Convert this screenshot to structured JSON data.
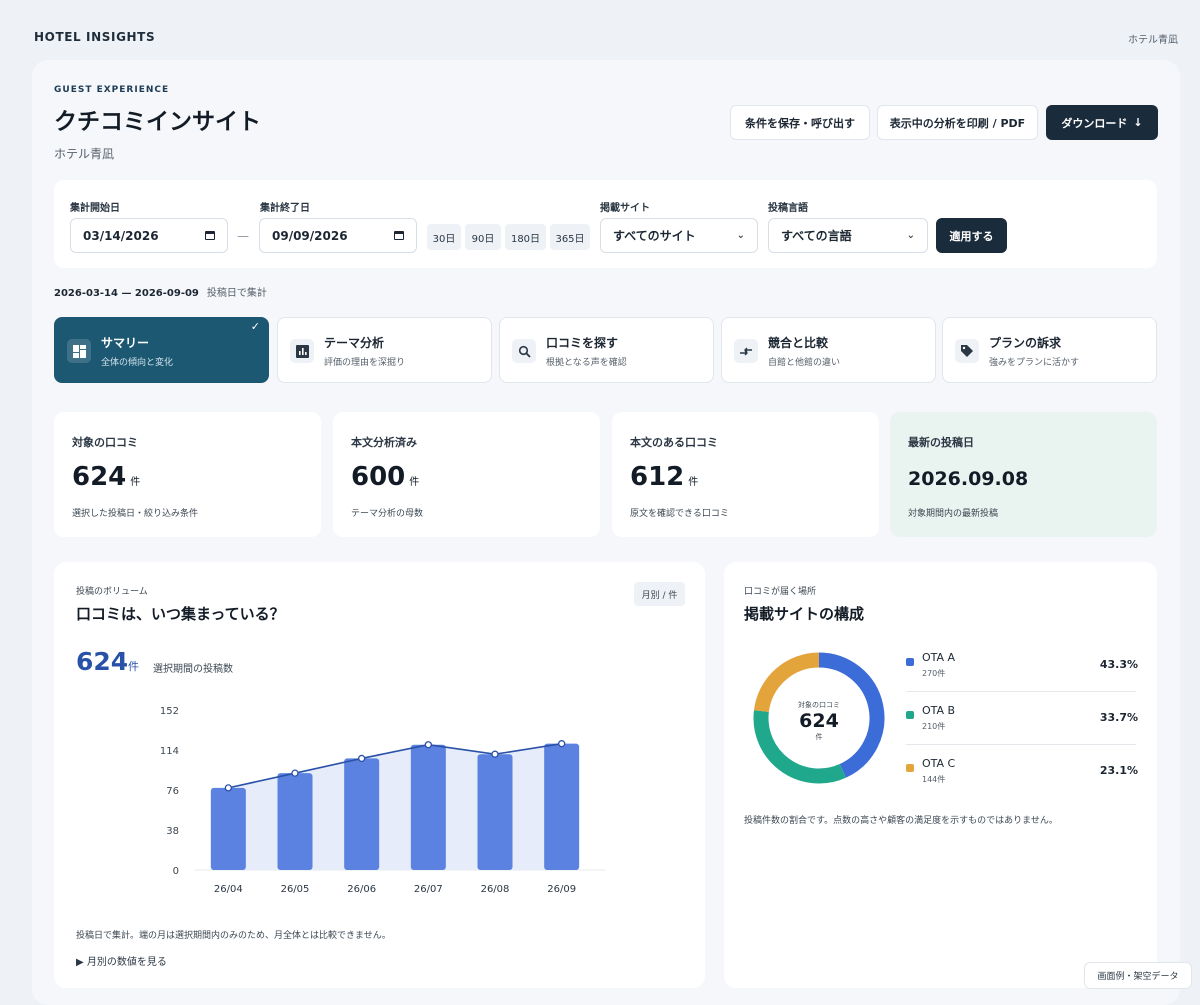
{
  "header": {
    "brand": "HOTEL INSIGHTS",
    "hotel_name": "ホテル青凪"
  },
  "page": {
    "eyebrow": "GUEST EXPERIENCE",
    "title": "クチコミインサイト",
    "subtitle": "ホテル青凪"
  },
  "actions": {
    "save_load": "条件を保存・呼び出す",
    "print": "表示中の分析を印刷 / PDF",
    "download": "ダウンロード",
    "download_icon": "↓"
  },
  "filters": {
    "start_label": "集計開始日",
    "start_value": "03/14/2026",
    "end_label": "集計終了日",
    "end_value": "09/09/2026",
    "range_separator": "—",
    "quick_ranges": [
      "30日",
      "90日",
      "180日",
      "365日"
    ],
    "site_label": "掲載サイト",
    "site_value": "すべてのサイト",
    "lang_label": "投稿言語",
    "lang_value": "すべての言語",
    "apply": "適用する"
  },
  "range": {
    "text": "2026-03-14 — 2026-09-09",
    "basis": "投稿日で集計"
  },
  "nav": {
    "check": "✓",
    "tabs": [
      {
        "title": "サマリー",
        "sub": "全体の傾向と変化"
      },
      {
        "title": "テーマ分析",
        "sub": "評価の理由を深掘り"
      },
      {
        "title": "口コミを探す",
        "sub": "根拠となる声を確認"
      },
      {
        "title": "競合と比較",
        "sub": "自館と他館の違い"
      },
      {
        "title": "プランの訴求",
        "sub": "強みをプランに活かす"
      }
    ]
  },
  "kpis": [
    {
      "label": "対象の口コミ",
      "value": "624",
      "unit": "件",
      "note": "選択した投稿日・絞り込み条件"
    },
    {
      "label": "本文分析済み",
      "value": "600",
      "unit": "件",
      "note": "テーマ分析の母数"
    },
    {
      "label": "本文のある口コミ",
      "value": "612",
      "unit": "件",
      "note": "原文を確認できる口コミ"
    },
    {
      "label": "最新の投稿日",
      "value": "2026.09.08",
      "note": "対象期間内の最新投稿"
    }
  ],
  "volume": {
    "eyebrow": "投稿のボリューム",
    "title": "口コミは、いつ集まっている？",
    "chip": "月別 / 件",
    "total": "624",
    "unit": "件",
    "desc": "選択期間の投稿数",
    "note": "投稿日で集計。端の月は選択期間内のみのため、月全体とは比較できません。",
    "details": "▶ 月別の数値を見る"
  },
  "sites": {
    "eyebrow": "口コミが届く場所",
    "title": "掲載サイトの構成",
    "center_label": "対象の口コミ",
    "center_value": "624",
    "center_unit": "件",
    "legend": [
      {
        "name": "OTA A",
        "count": "270件",
        "pct": "43.3%"
      },
      {
        "name": "OTA B",
        "count": "210件",
        "pct": "33.7%"
      },
      {
        "name": "OTA C",
        "count": "144件",
        "pct": "23.1%"
      }
    ],
    "note": "投稿件数の割合です。点数の高さや顧客の満足度を示すものではありません。"
  },
  "badge": "画面例・架空データ",
  "colors": {
    "accent": "#1d5873",
    "dark_button": "#1a2b3c",
    "bar": "#5b82e0",
    "line": "#2a51a8",
    "ota_a": "#3c6cd8",
    "ota_b": "#1fa88c",
    "ota_c": "#e3a43c"
  },
  "chart_data": [
    {
      "type": "bar",
      "categories": [
        "26/04",
        "26/05",
        "26/06",
        "26/07",
        "26/08",
        "26/09"
      ],
      "series": [
        {
          "values": [
            78,
            92,
            106,
            119,
            110,
            120
          ]
        }
      ],
      "yticks": [
        0,
        38,
        76,
        114,
        152
      ],
      "ylim": [
        0,
        152
      ],
      "overlay": "line",
      "grid": false
    },
    {
      "type": "pie",
      "categories": [
        "OTA A",
        "OTA B",
        "OTA C"
      ],
      "values": [
        270,
        210,
        144
      ],
      "percent": [
        43.3,
        33.7,
        23.1
      ],
      "donut": true
    }
  ]
}
